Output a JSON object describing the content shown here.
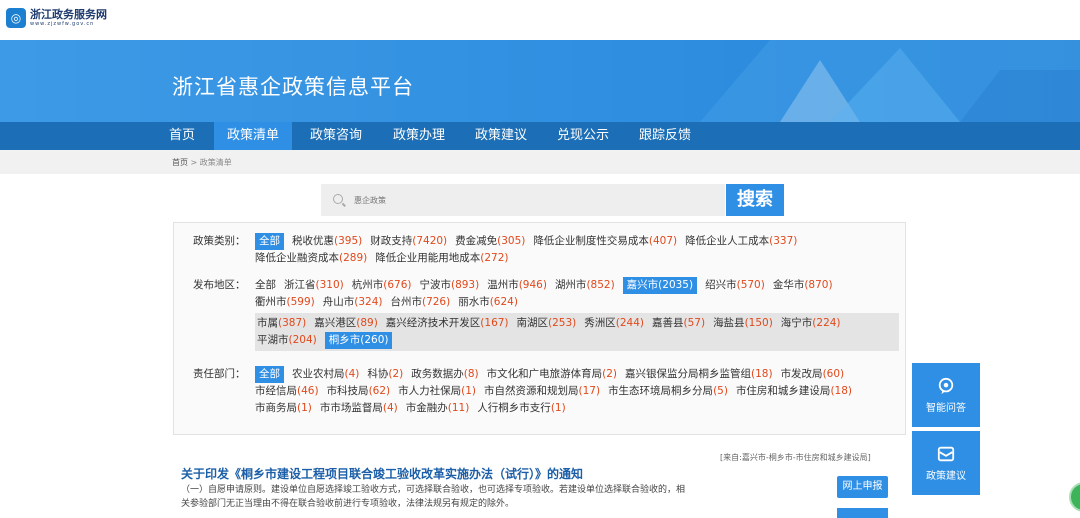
{
  "logo": {
    "name": "浙江政务服务网",
    "url": "www.zjzwfw.gov.cn"
  },
  "banner": {
    "title": "浙江省惠企政策信息平台"
  },
  "nav": [
    {
      "label": "首页"
    },
    {
      "label": "政策清单",
      "active": true
    },
    {
      "label": "政策咨询"
    },
    {
      "label": "政策办理"
    },
    {
      "label": "政策建议"
    },
    {
      "label": "兑现公示"
    },
    {
      "label": "跟踪反馈"
    }
  ],
  "breadcrumb": {
    "home": "首页",
    "sep": ">",
    "current": "政策清单"
  },
  "search": {
    "placeholder": "惠企政策",
    "button": "搜索"
  },
  "filters": {
    "category": {
      "label": "政策类别：",
      "options": [
        {
          "name": "全部",
          "selected": true
        },
        {
          "name": "税收优惠",
          "count": "(395)"
        },
        {
          "name": "财政支持",
          "count": "(7420)"
        },
        {
          "name": "费金减免",
          "count": "(305)"
        },
        {
          "name": "降低企业制度性交易成本",
          "count": "(407)"
        },
        {
          "name": "降低企业人工成本",
          "count": "(337)"
        },
        {
          "name": "降低企业融资成本",
          "count": "(289)"
        },
        {
          "name": "降低企业用能用地成本",
          "count": "(272)"
        }
      ]
    },
    "region": {
      "label": "发布地区：",
      "options": [
        {
          "name": "全部"
        },
        {
          "name": "浙江省",
          "count": "(310)"
        },
        {
          "name": "杭州市",
          "count": "(676)"
        },
        {
          "name": "宁波市",
          "count": "(893)"
        },
        {
          "name": "温州市",
          "count": "(946)"
        },
        {
          "name": "湖州市",
          "count": "(852)"
        },
        {
          "name": "嘉兴市",
          "count": "(2035)",
          "selected": true
        },
        {
          "name": "绍兴市",
          "count": "(570)"
        },
        {
          "name": "金华市",
          "count": "(870)"
        },
        {
          "name": "衢州市",
          "count": "(599)"
        },
        {
          "name": "舟山市",
          "count": "(324)"
        },
        {
          "name": "台州市",
          "count": "(726)"
        },
        {
          "name": "丽水市",
          "count": "(624)"
        }
      ],
      "sub_options": [
        {
          "name": "市属",
          "count": "(387)"
        },
        {
          "name": "嘉兴港区",
          "count": "(89)"
        },
        {
          "name": "嘉兴经济技术开发区",
          "count": "(167)"
        },
        {
          "name": "南湖区",
          "count": "(253)"
        },
        {
          "name": "秀洲区",
          "count": "(244)"
        },
        {
          "name": "嘉善县",
          "count": "(57)"
        },
        {
          "name": "海盐县",
          "count": "(150)"
        },
        {
          "name": "海宁市",
          "count": "(224)"
        },
        {
          "name": "平湖市",
          "count": "(204)"
        },
        {
          "name": "桐乡市",
          "count": "(260)",
          "selected": true
        }
      ]
    },
    "department": {
      "label": "责任部门：",
      "options": [
        {
          "name": "全部",
          "selected": true
        },
        {
          "name": "农业农村局",
          "count": "(4)"
        },
        {
          "name": "科协",
          "count": "(2)"
        },
        {
          "name": "政务数据办",
          "count": "(8)"
        },
        {
          "name": "市文化和广电旅游体育局",
          "count": "(2)"
        },
        {
          "name": "嘉兴银保监分局桐乡监管组",
          "count": "(18)"
        },
        {
          "name": "市发改局",
          "count": "(60)"
        },
        {
          "name": "市经信局",
          "count": "(46)"
        },
        {
          "name": "市科技局",
          "count": "(62)"
        },
        {
          "name": "市人力社保局",
          "count": "(1)"
        },
        {
          "name": "市自然资源和规划局",
          "count": "(17)"
        },
        {
          "name": "市生态环境局桐乡分局",
          "count": "(5)"
        },
        {
          "name": "市住房和城乡建设局",
          "count": "(18)"
        },
        {
          "name": "市商务局",
          "count": "(1)"
        },
        {
          "name": "市市场监督局",
          "count": "(4)"
        },
        {
          "name": "市金融办",
          "count": "(11)"
        },
        {
          "name": "人行桐乡市支行",
          "count": "(1)"
        }
      ]
    }
  },
  "policy": {
    "source": "[来自:嘉兴市-桐乡市-市住房和城乡建设局]",
    "title": "关于印发《桐乡市建设工程项目联合竣工验收改革实施办法（试行）》的通知",
    "desc1": "（一）自愿申请原则。建设单位自愿选择竣工验收方式，可选择联合验收，也可选择专项验收。若建设单位选择联合验收的，相",
    "desc2": "关参验部门无正当理由不得在联合验收前进行专项验收，法律法规另有规定的除外。",
    "apply": "网上申报"
  },
  "side": {
    "qa": "智能问答",
    "suggest": "政策建议"
  },
  "colors": {
    "accent": "#2f8fe5",
    "nav": "#1c6fb6",
    "count": "#e0491c"
  }
}
